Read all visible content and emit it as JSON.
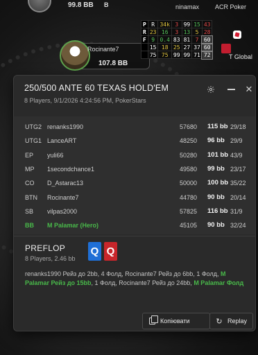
{
  "table": {
    "top_seat_stack": "99.8 BB",
    "top_b_tag": "B",
    "top_site_partial": "ninamax",
    "top_link": "ACR Poker",
    "hero_seat": {
      "name": "Rocinante7",
      "stack": "107.8 BB"
    },
    "hud": {
      "rows": [
        [
          "P",
          "R",
          "34k",
          "3",
          "99",
          "15",
          "43"
        ],
        [
          "R",
          "23",
          "16",
          "3",
          "13",
          "5",
          "28"
        ],
        [
          "F",
          "9",
          "0.4",
          "83",
          "81",
          "7",
          "60"
        ],
        [
          "",
          "15",
          "18",
          "25",
          "27",
          "37",
          "60"
        ],
        [
          "",
          "75",
          "75",
          "99",
          "99",
          "71",
          "72"
        ]
      ]
    },
    "side_label": "T Global",
    "colors": {
      "hud_red": "#e04848",
      "hud_green": "#55c35a",
      "hud_yellow": "#e2c53d"
    }
  },
  "popup": {
    "title": "250/500 ANTE 60 TEXAS HOLD'EM",
    "subtitle": "8 Players, 9/1/2026 4:24:56 PM, PokerStars",
    "icons": {
      "settings": "gear-icon",
      "minimize": "minimize-icon",
      "close": "close-icon"
    },
    "close_glyph": "✕",
    "players": [
      {
        "pos": "UTG2",
        "name": "renanks1990",
        "chips": "57680",
        "bb": "115 bb",
        "stat": "29/18",
        "hero": false
      },
      {
        "pos": "UTG1",
        "name": "LanceART",
        "chips": "48250",
        "bb": "96 bb",
        "stat": "29/9",
        "hero": false
      },
      {
        "pos": "EP",
        "name": "yuli66",
        "chips": "50280",
        "bb": "101 bb",
        "stat": "43/9",
        "hero": false
      },
      {
        "pos": "MP",
        "name": "1secondchance1",
        "chips": "49580",
        "bb": "99 bb",
        "stat": "23/17",
        "hero": false
      },
      {
        "pos": "CO",
        "name": "D_Astarac13",
        "chips": "50000",
        "bb": "100 bb",
        "stat": "35/22",
        "hero": false
      },
      {
        "pos": "BTN",
        "name": "Rocinante7",
        "chips": "44780",
        "bb": "90 bb",
        "stat": "20/14",
        "hero": false
      },
      {
        "pos": "SB",
        "name": "vilpas2000",
        "chips": "57825",
        "bb": "116 bb",
        "stat": "31/9",
        "hero": false
      },
      {
        "pos": "BB",
        "name": "M Palamar (Hero)",
        "chips": "45105",
        "bb": "90 bb",
        "stat": "32/24",
        "hero": true
      }
    ],
    "street": {
      "name": "PREFLOP",
      "sub": "8 Players, 2.46 bb",
      "cards": [
        "Q",
        "Q"
      ],
      "card_colors": [
        "#1f6fd6",
        "#c8262b"
      ],
      "actions_1": "renanks1990 Рейз до 2bb, 4 Фолд, Rocinante7 Рейз до 6bb, 1 Фолд,",
      "actions_hero_1": "M Palamar Рейз до 15bb",
      "actions_2": ", 1 Фолд, Rocinante7 Рейз до 24bb,",
      "actions_hero_2": "M Palamar Фолд"
    },
    "buttons": {
      "copy": "Копіювати",
      "replay": "Replay",
      "replay_glyph": "↻"
    }
  }
}
